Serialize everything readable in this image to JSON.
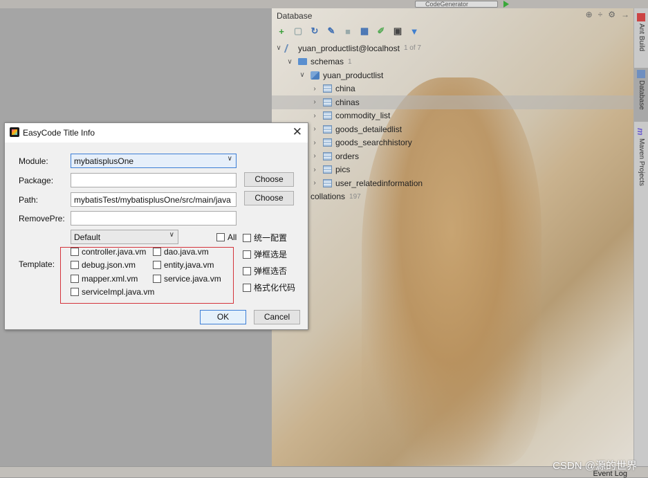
{
  "topbar": {
    "run_config": "CodeGenerator"
  },
  "database_panel": {
    "title": "Database",
    "tree": [
      {
        "label": "yuan_productlist@localhost",
        "meta": "1 of 7",
        "type": "datasource",
        "level": 0,
        "expanded": true
      },
      {
        "label": "schemas",
        "meta": "1",
        "type": "folder",
        "level": 1,
        "expanded": true
      },
      {
        "label": "yuan_productlist",
        "meta": "",
        "type": "schema",
        "level": 2,
        "expanded": true
      },
      {
        "label": "china",
        "meta": "",
        "type": "table",
        "level": 3
      },
      {
        "label": "chinas",
        "meta": "",
        "type": "table",
        "level": 3,
        "selected": true
      },
      {
        "label": "commodity_list",
        "meta": "",
        "type": "table",
        "level": 3
      },
      {
        "label": "goods_detailedlist",
        "meta": "",
        "type": "table",
        "level": 3
      },
      {
        "label": "goods_searchhistory",
        "meta": "",
        "type": "table",
        "level": 3
      },
      {
        "label": "orders",
        "meta": "",
        "type": "table",
        "level": 3
      },
      {
        "label": "pics",
        "meta": "",
        "type": "table",
        "level": 3
      },
      {
        "label": "user_relatedinformation",
        "meta": "",
        "type": "table",
        "level": 3
      },
      {
        "label": "collations",
        "meta": "197",
        "type": "folder",
        "level": 1
      }
    ]
  },
  "side_tabs": [
    "Ant Build",
    "Database",
    "Maven Projects"
  ],
  "dialog": {
    "title": "EasyCode Title Info",
    "module_label": "Module:",
    "module_value": "mybatisplusOne",
    "package_label": "Package:",
    "package_value": "",
    "path_label": "Path:",
    "path_value": "mybatisTest/mybatisplusOne/src/main/java",
    "removepre_label": "RemovePre:",
    "removepre_value": "",
    "choose_label": "Choose",
    "template_label": "Template:",
    "template_group": "Default",
    "all_label": "All",
    "templates": [
      "controller.java.vm",
      "dao.java.vm",
      "debug.json.vm",
      "entity.java.vm",
      "mapper.xml.vm",
      "service.java.vm",
      "serviceImpl.java.vm"
    ],
    "options": [
      "统一配置",
      "弹框选是",
      "弹框选否",
      "格式化代码"
    ],
    "ok_label": "OK",
    "cancel_label": "Cancel"
  },
  "statusbar": {
    "event_log": "Event Log"
  },
  "watermark": "CSDN @源的世界"
}
